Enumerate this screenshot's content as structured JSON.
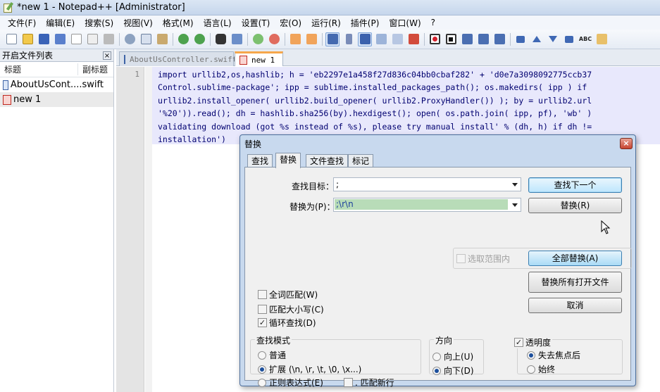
{
  "window": {
    "title": "*new  1 - Notepad++ [Administrator]"
  },
  "menu": [
    "文件(F)",
    "编辑(E)",
    "搜索(S)",
    "视图(V)",
    "格式(M)",
    "语言(L)",
    "设置(T)",
    "宏(O)",
    "运行(R)",
    "插件(P)",
    "窗口(W)",
    "?"
  ],
  "toolbar_icons": [
    "new-file-icon",
    "open-file-icon",
    "save-icon",
    "save-all-icon",
    "close-icon",
    "close-all-icon",
    "print-icon",
    "cut-icon",
    "copy-icon",
    "paste-icon",
    "undo-icon",
    "redo-icon",
    "find-icon",
    "replace-icon",
    "zoom-in-icon",
    "zoom-out-icon",
    "sync-vertical-icon",
    "sync-horizontal-icon",
    "word-wrap-icon",
    "all-chars-icon",
    "indent-guide-icon",
    "doc-map-icon",
    "function-list-icon",
    "record-macro-icon",
    "stop-record-icon",
    "play-macro-icon",
    "play-multiple-icon",
    "save-macro-icon",
    "fold-up-icon",
    "up-icon",
    "down-icon",
    "fold-down-icon",
    "spellcheck-icon",
    "clipboard-icon"
  ],
  "doclist": {
    "title": "开启文件列表",
    "col_name": "标题",
    "col_ext": "副标题",
    "files": [
      {
        "name": "AboutUsCont...",
        "ext": ".swift"
      },
      {
        "name": "new  1",
        "ext": ""
      }
    ]
  },
  "tabs": [
    {
      "label": "AboutUsController.swift"
    },
    {
      "label": "new  1"
    }
  ],
  "editor": {
    "line_number": "1",
    "lines": [
      "import urllib2,os,hashlib; h = 'eb2297e1a458f27d836c04bb0cbaf282' + 'd0e7a3098092775ccb37",
      "Control.sublime-package'; ipp = sublime.installed_packages_path(); os.makedirs( ipp ) if",
      "urllib2.install_opener( urllib2.build_opener( urllib2.ProxyHandler()) ); by = urllib2.url",
      "'%20')).read(); dh = hashlib.sha256(by).hexdigest(); open( os.path.join( ipp, pf), 'wb' )",
      "validating download (got %s instead of %s), please try manual install' % (dh, h) if dh !=",
      "installation')"
    ]
  },
  "dialog": {
    "title": "替换",
    "tabs": [
      "查找",
      "替换",
      "文件查找",
      "标记"
    ],
    "find_label": "查找目标：",
    "find_value": ";",
    "replace_label": "替换为(P)：",
    "replace_value": ";\\r\\n",
    "in_selection": "选取范围内",
    "buttons": {
      "find_next": "查找下一个",
      "replace": "替换(R)",
      "replace_all": "全部替换(A)",
      "replace_all_open": "替换所有打开文件",
      "cancel": "取消"
    },
    "options": {
      "whole_word": "全词匹配(W)",
      "match_case": "匹配大小写(C)",
      "wrap_around": "循环查找(D)"
    },
    "search_mode": {
      "title": "查找模式",
      "normal": "普通",
      "extended": "扩展 (\\n, \\r, \\t, \\0, \\x...)",
      "regex": "正则表达式(E)",
      "dot_newline": ". 匹配新行"
    },
    "direction": {
      "title": "方向",
      "up": "向上(U)",
      "down": "向下(D)"
    },
    "transparency": {
      "title": "透明度",
      "on_lose_focus": "失去焦点后",
      "always": "始终"
    }
  },
  "colors": {
    "code_text": "#000070",
    "code_bg": "#e8e8fc",
    "active_tab_accent": "#f6a74b",
    "close_button": "#c7442f"
  }
}
